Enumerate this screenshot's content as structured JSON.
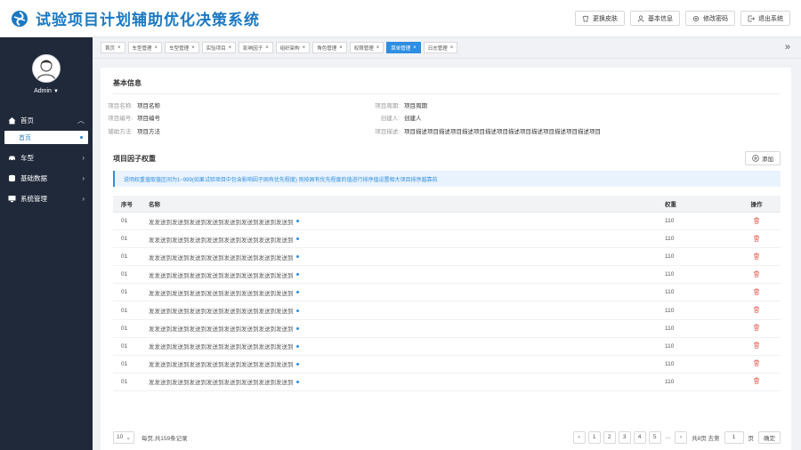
{
  "app": {
    "title": "试验项目计划辅助优化决策系统"
  },
  "header": {
    "actions": [
      {
        "label": "更换皮肤",
        "icon": "skin-icon"
      },
      {
        "label": "基本信息",
        "icon": "user-icon"
      },
      {
        "label": "修改密码",
        "icon": "gear-icon"
      },
      {
        "label": "退出系统",
        "icon": "logout-icon"
      }
    ]
  },
  "sidebar": {
    "user": "Admin",
    "items": [
      {
        "label": "首页",
        "icon": "home-icon",
        "expanded": true,
        "sub": [
          {
            "label": "首页",
            "active": true
          }
        ]
      },
      {
        "label": "车型",
        "icon": "car-icon"
      },
      {
        "label": "基础数据",
        "icon": "database-icon"
      },
      {
        "label": "系统管理",
        "icon": "monitor-icon"
      }
    ]
  },
  "tabs": [
    {
      "label": "首页",
      "active": false
    },
    {
      "label": "车型管理",
      "active": false
    },
    {
      "label": "车型管理",
      "active": false
    },
    {
      "label": "实验项目",
      "active": false
    },
    {
      "label": "影响因子",
      "active": false
    },
    {
      "label": "组织架构",
      "active": false
    },
    {
      "label": "角色管理",
      "active": false
    },
    {
      "label": "权限管理",
      "active": false
    },
    {
      "label": "菜单管理",
      "active": true
    },
    {
      "label": "日志管理",
      "active": false
    }
  ],
  "basic_info": {
    "title": "基本信息",
    "fields": {
      "project_name": {
        "label": "项目名称:",
        "value": "项目名称"
      },
      "project_cycle": {
        "label": "项目周期:",
        "value": "项目周期"
      },
      "project_code": {
        "label": "项目编号:",
        "value": "项目编号"
      },
      "creator": {
        "label": "创建人:",
        "value": "创建人"
      },
      "test_method": {
        "label": "辅助方法:",
        "value": "项目方法"
      },
      "description": {
        "label": "项目描述:",
        "value": "项目描述项目描述项目描述项目描述项目描述项目描述项目描述项目描述项目"
      }
    }
  },
  "factor_weight": {
    "title": "项目因子权重",
    "add_label": "添加",
    "notice": "说明权重值取值区间为1~999(如果试验项目中包含影响因子固有优先程度) 则按固有优先程度的值进行排序值设置相大项目排序越靠前",
    "columns": {
      "index": "序号",
      "name": "名称",
      "weight": "权重",
      "ops": "操作"
    },
    "rows": [
      {
        "index": "01",
        "name": "发发送到发送到发送到发送到发送到发送到发送到发送到",
        "weight": "110"
      },
      {
        "index": "01",
        "name": "发发送到发送到发送到发送到发送到发送到发送到发送到",
        "weight": "110"
      },
      {
        "index": "01",
        "name": "发发送到发送到发送到发送到发送到发送到发送到发送到",
        "weight": "110"
      },
      {
        "index": "01",
        "name": "发发送到发送到发送到发送到发送到发送到发送到发送到",
        "weight": "110"
      },
      {
        "index": "01",
        "name": "发发送到发送到发送到发送到发送到发送到发送到发送到",
        "weight": "110"
      },
      {
        "index": "01",
        "name": "发发送到发送到发送到发送到发送到发送到发送到发送到",
        "weight": "110"
      },
      {
        "index": "01",
        "name": "发发送到发送到发送到发送到发送到发送到发送到发送到",
        "weight": "110"
      },
      {
        "index": "01",
        "name": "发发送到发送到发送到发送到发送到发送到发送到发送到",
        "weight": "110"
      },
      {
        "index": "01",
        "name": "发发送到发送到发送到发送到发送到发送到发送到发送到",
        "weight": "110"
      },
      {
        "index": "01",
        "name": "发发送到发送到发送到发送到发送到发送到发送到发送到",
        "weight": "110"
      }
    ]
  },
  "pagination": {
    "page_size": "10",
    "total_text": "每页,共159条记录",
    "pages": [
      "1",
      "2",
      "3",
      "4",
      "5"
    ],
    "ellipsis": "...",
    "total_pages_text": "共8页 去第",
    "goto_value": "1",
    "page_unit": "页",
    "confirm": "确定"
  },
  "colors": {
    "primary": "#2f8ee0",
    "sidebar": "#20293a",
    "title": "#1a78c2",
    "danger": "#e8594f"
  }
}
